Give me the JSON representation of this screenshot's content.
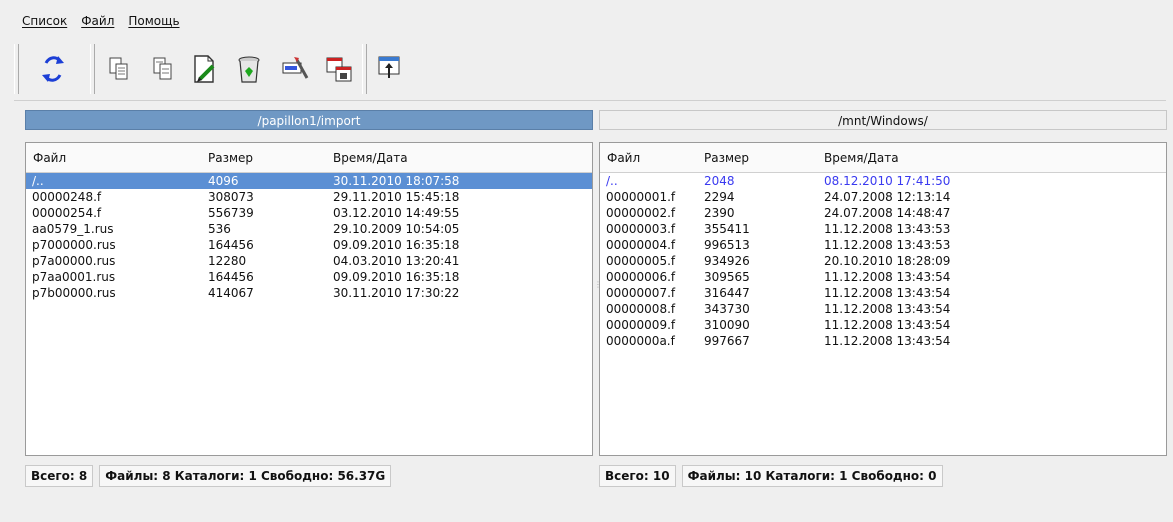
{
  "menu": {
    "items": [
      "Список",
      "Файл",
      "Помощь"
    ]
  },
  "toolbar": {
    "buttons": [
      "refresh-icon",
      "copy-icon",
      "copy-alt-icon",
      "edit-document-icon",
      "recycle-bin-icon",
      "rename-icon",
      "copy-dialog-icon",
      "window-up-icon"
    ]
  },
  "left": {
    "path": "/papillon1/import",
    "columns": [
      "Файл",
      "Размер",
      "Время/Дата"
    ],
    "rows": [
      [
        "/..",
        "4096",
        "30.11.2010 18:07:58"
      ],
      [
        "00000248.f",
        "308073",
        "29.11.2010 15:45:18"
      ],
      [
        "00000254.f",
        "556739",
        "03.12.2010 14:49:55"
      ],
      [
        "aa0579_1.rus",
        "536",
        "29.10.2009 10:54:05"
      ],
      [
        "p7000000.rus",
        "164456",
        "09.09.2010 16:35:18"
      ],
      [
        "p7a00000.rus",
        "12280",
        "04.03.2010 13:20:41"
      ],
      [
        "p7aa0001.rus",
        "164456",
        "09.09.2010 16:35:18"
      ],
      [
        "p7b00000.rus",
        "414067",
        "30.11.2010 17:30:22"
      ]
    ],
    "status": {
      "total": "Всего: 8",
      "summary": "Файлы: 8 Каталоги: 1 Свободно: 56.37G"
    }
  },
  "right": {
    "path": "/mnt/Windows/",
    "columns": [
      "Файл",
      "Размер",
      "Время/Дата"
    ],
    "rows": [
      [
        "/..",
        "2048",
        "08.12.2010 17:41:50"
      ],
      [
        "00000001.f",
        "2294",
        "24.07.2008 12:13:14"
      ],
      [
        "00000002.f",
        "2390",
        "24.07.2008 14:48:47"
      ],
      [
        "00000003.f",
        "355411",
        "11.12.2008 13:43:53"
      ],
      [
        "00000004.f",
        "996513",
        "11.12.2008 13:43:53"
      ],
      [
        "00000005.f",
        "934926",
        "20.10.2010 18:28:09"
      ],
      [
        "00000006.f",
        "309565",
        "11.12.2008 13:43:54"
      ],
      [
        "00000007.f",
        "316447",
        "11.12.2008 13:43:54"
      ],
      [
        "00000008.f",
        "343730",
        "11.12.2008 13:43:54"
      ],
      [
        "00000009.f",
        "310090",
        "11.12.2008 13:43:54"
      ],
      [
        "0000000a.f",
        "997667",
        "11.12.2008 13:43:54"
      ]
    ],
    "status": {
      "total": "Всего: 10",
      "summary": "Файлы: 10 Каталоги: 1 Свободно: 0"
    }
  },
  "colors": {
    "selection": "#5b8fd4",
    "active_path": "#6f98c4",
    "highlight_text": "#3a3af0"
  }
}
